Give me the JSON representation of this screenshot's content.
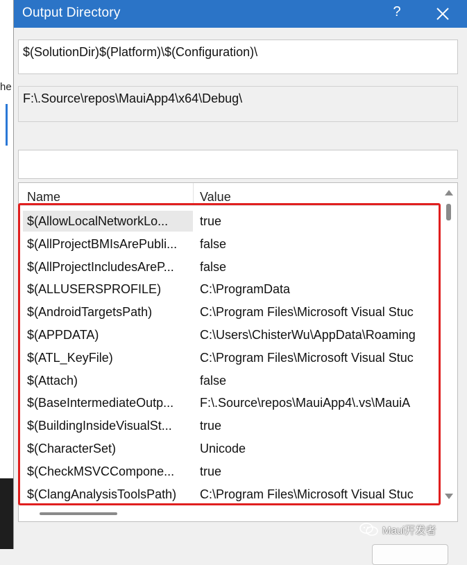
{
  "background": {
    "fragment_text": "he"
  },
  "dialog": {
    "title": "Output Directory",
    "help_label": "?",
    "edit_value": "$(SolutionDir)$(Platform)\\$(Configuration)\\",
    "evaluated_value": "F:\\.Source\\repos\\MauiApp4\\x64\\Debug\\",
    "filter_value": ""
  },
  "macro_list": {
    "columns": [
      "Name",
      "Value"
    ],
    "rows": [
      {
        "name": "$(AllowLocalNetworkLo...",
        "value": "true"
      },
      {
        "name": "$(AllProjectBMIsArePubli...",
        "value": "false"
      },
      {
        "name": "$(AllProjectIncludesAreP...",
        "value": "false"
      },
      {
        "name": "$(ALLUSERSPROFILE)",
        "value": "C:\\ProgramData"
      },
      {
        "name": "$(AndroidTargetsPath)",
        "value": "C:\\Program Files\\Microsoft Visual Stuc"
      },
      {
        "name": "$(APPDATA)",
        "value": "C:\\Users\\ChisterWu\\AppData\\Roaming"
      },
      {
        "name": "$(ATL_KeyFile)",
        "value": "C:\\Program Files\\Microsoft Visual Stuc"
      },
      {
        "name": "$(Attach)",
        "value": "false"
      },
      {
        "name": "$(BaseIntermediateOutp...",
        "value": "F:\\.Source\\repos\\MauiApp4\\.vs\\MauiA"
      },
      {
        "name": "$(BuildingInsideVisualSt...",
        "value": "true"
      },
      {
        "name": "$(CharacterSet)",
        "value": "Unicode"
      },
      {
        "name": "$(CheckMSVCCompone...",
        "value": "true"
      },
      {
        "name": "$(ClangAnalysisToolsPath)",
        "value": "C:\\Program Files\\Microsoft Visual Stuc"
      }
    ]
  },
  "watermark": {
    "text": "Maui开发者"
  },
  "colors": {
    "title_bar": "#2b74c7",
    "highlight": "#e01f1f",
    "dialog_bg": "#f0f0f0"
  },
  "icons": {
    "close": "close-icon",
    "scroll_up": "scroll-up-icon",
    "scroll_down": "scroll-down-icon",
    "watermark_logo": "wechat-icon"
  }
}
